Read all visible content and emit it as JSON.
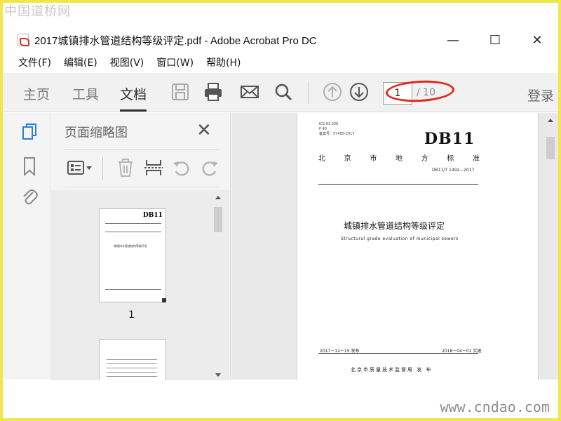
{
  "watermark": {
    "top": "中国道桥网",
    "bottom": "www.cndao.com"
  },
  "window": {
    "title": "2017城镇排水管道结构等级评定.pdf - Adobe Acrobat Pro DC",
    "controls": {
      "minimize": "—",
      "maximize": "☐",
      "close": "✕"
    }
  },
  "menu": [
    "文件(F)",
    "编辑(E)",
    "视图(V)",
    "窗口(W)",
    "帮助(H)"
  ],
  "toolbar": {
    "tabs": [
      {
        "label": "主页"
      },
      {
        "label": "工具"
      },
      {
        "label": "文档",
        "active": true
      }
    ],
    "page_current": "1",
    "page_total": "/ 10",
    "login": "登录",
    "icons": [
      "save-icon",
      "print-icon",
      "email-icon",
      "search-icon",
      "page-up-icon",
      "page-down-icon"
    ]
  },
  "left_rail": [
    "page-thumbnails-icon",
    "bookmark-icon",
    "attachment-icon"
  ],
  "panel": {
    "title": "页面缩略图",
    "close": "✕",
    "tools": [
      "thumbnail-options-icon",
      "delete-page-icon",
      "insert-page-icon",
      "rotate-left-icon",
      "rotate-right-icon"
    ],
    "thumbnail_page_number": "1",
    "thumb1": {
      "code": "DB11",
      "title": "城镇排水管道结构等级评定"
    }
  },
  "document": {
    "top_meta": [
      "ICS 93.030",
      "P 40",
      "备案号：57495-2017"
    ],
    "code": "DB11",
    "standard_type": [
      "北",
      "京",
      "市",
      "地",
      "方",
      "标",
      "准"
    ],
    "std_number": "DB11/T 1492—2017",
    "title_cn": "城镇排水管道结构等级评定",
    "title_en": "Structural grade evaluation of municipal sewers",
    "issue_date": "2017－12－15 发布",
    "impl_date": "2018－04－01 实施",
    "publisher": "北京市质量技术监督局  发 布"
  },
  "colors": {
    "frame": "#f0e74a",
    "highlight": "#e3291f",
    "toolbar_bg": "#f1f1f1"
  }
}
